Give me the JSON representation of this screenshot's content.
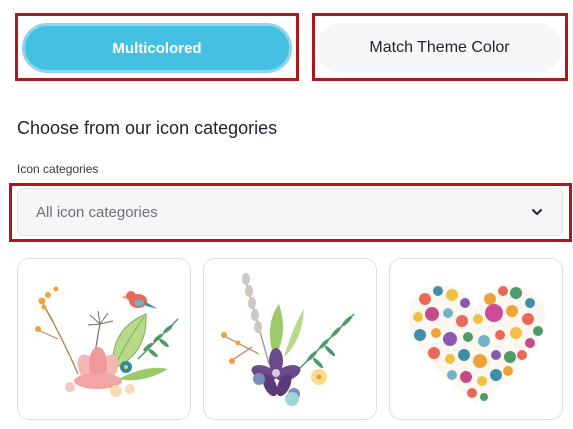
{
  "color_mode": {
    "multicolored_label": "Multicolored",
    "theme_label": "Match Theme Color",
    "active": "Multicolored",
    "accent_color": "#46c0e2"
  },
  "section": {
    "heading": "Choose from our icon categories",
    "field_label": "Icon categories",
    "select_value": "All icon categories",
    "select_icon": "chevron-down-icon"
  },
  "cards": [
    {
      "name": "floral-bird-bouquet"
    },
    {
      "name": "wildflower-lavender-sprig"
    },
    {
      "name": "flower-heart-wreath"
    }
  ],
  "highlight_color": "#a81a1f"
}
